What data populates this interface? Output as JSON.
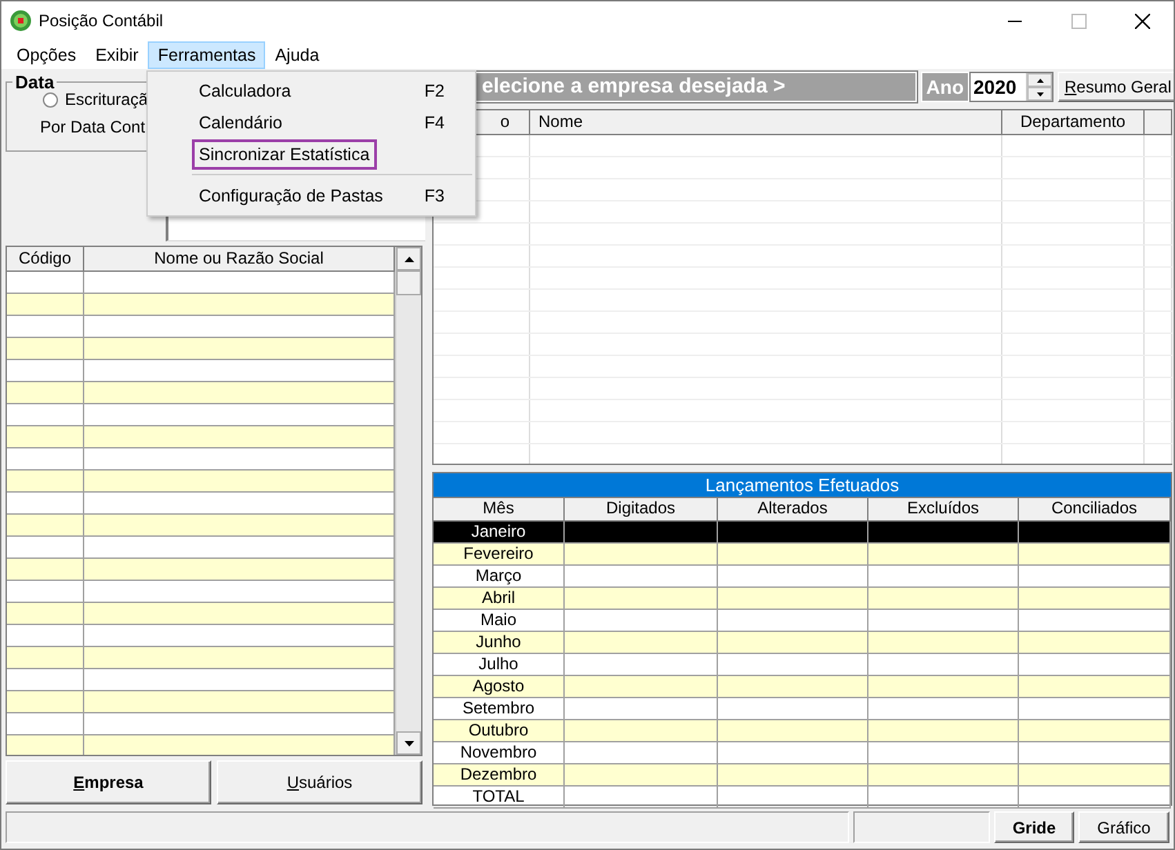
{
  "window": {
    "title": "Posição Contábil"
  },
  "menu_bar": [
    {
      "label": "Opções",
      "selected": false
    },
    {
      "label": "Exibir",
      "selected": false
    },
    {
      "label": "Ferramentas",
      "selected": true
    },
    {
      "label": "Ajuda",
      "selected": false
    }
  ],
  "dropdown_menu": {
    "items": [
      {
        "kind": "item",
        "label": "Calculadora",
        "shortcut": "F2",
        "highlighted": false
      },
      {
        "kind": "item",
        "label": "Calendário",
        "shortcut": "F4",
        "highlighted": false
      },
      {
        "kind": "item",
        "label": "Sincronizar Estatística",
        "highlighted": true
      },
      {
        "kind": "separator"
      },
      {
        "kind": "item",
        "label": "Configuração de Pastas",
        "shortcut": "F3",
        "highlighted": false
      }
    ]
  },
  "data_group": {
    "title": "Data",
    "radio": {
      "label": "Escrituraçã",
      "checked": false
    },
    "caption": "Por Data Cont"
  },
  "company_list": {
    "columns": [
      "Código",
      "Nome ou Razão Social"
    ]
  },
  "left_buttons": [
    {
      "label": "Empresa",
      "default": true
    },
    {
      "label": "Usuários",
      "default": false
    }
  ],
  "company_header": {
    "prompt": "elecione a empresa desejada >",
    "year_label": "Ano",
    "year": "2020",
    "summary_button": "Resumo Geral"
  },
  "employee_table": {
    "columns": [
      "o",
      "Nome",
      "Departamento"
    ]
  },
  "entries_table": {
    "title": "Lançamentos Efetuados",
    "columns": [
      "Mês",
      "Digitados",
      "Alterados",
      "Excluídos",
      "Conciliados"
    ],
    "rows": [
      {
        "month": "Janeiro",
        "selected": true
      },
      {
        "month": "Fevereiro",
        "selected": false
      },
      {
        "month": "Março",
        "selected": false
      },
      {
        "month": "Abril",
        "selected": false
      },
      {
        "month": "Maio",
        "selected": false
      },
      {
        "month": "Junho",
        "selected": false
      },
      {
        "month": "Julho",
        "selected": false
      },
      {
        "month": "Agosto",
        "selected": false
      },
      {
        "month": "Setembro",
        "selected": false
      },
      {
        "month": "Outubro",
        "selected": false
      },
      {
        "month": "Novembro",
        "selected": false
      },
      {
        "month": "Dezembro",
        "selected": false
      },
      {
        "month": "TOTAL",
        "selected": false
      }
    ]
  },
  "status_bar": {
    "buttons": [
      {
        "label": "Gride",
        "default": true
      },
      {
        "label": "Gráfico",
        "default": false
      }
    ]
  }
}
